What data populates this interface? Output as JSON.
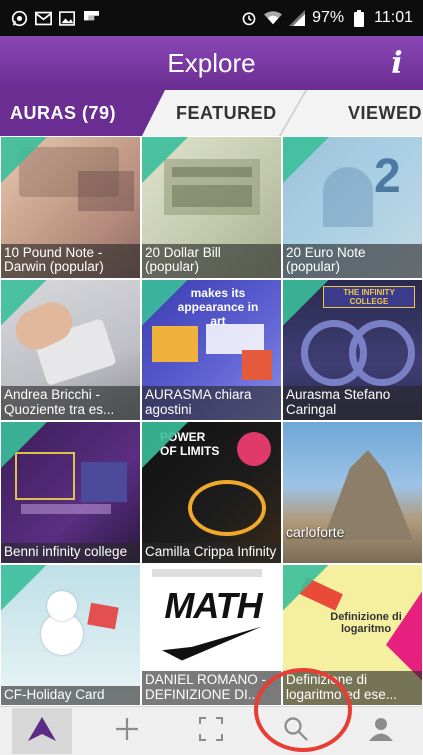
{
  "status_bar": {
    "battery": "97%",
    "time": "11:01",
    "icons_left": [
      "whatsapp-icon",
      "gmail-icon",
      "gallery-icon",
      "flipboard-icon"
    ],
    "icons_right": [
      "alarm-icon",
      "wifi-icon",
      "signal-icon",
      "battery-icon"
    ]
  },
  "header": {
    "title": "Explore",
    "info_label": "i"
  },
  "tabs": [
    {
      "label": "AURAS (79)",
      "active": true
    },
    {
      "label": "FEATURED",
      "active": false
    },
    {
      "label": "VIEWED",
      "active": false
    }
  ],
  "auras": [
    {
      "title": "10 Pound Note - Darwin (popular)"
    },
    {
      "title": "20 Dollar Bill (popular)"
    },
    {
      "title": "20 Euro Note (popular)"
    },
    {
      "title": "Andrea Bricchi - Quoziente tra es..."
    },
    {
      "title": "AURASMA chiara agostini"
    },
    {
      "title": "Aurasma Stefano Caringal"
    },
    {
      "title": "Benni infinity college"
    },
    {
      "title": "Camilla Crippa Infinity"
    },
    {
      "title": "carloforte"
    },
    {
      "title": "CF-Holiday Card"
    },
    {
      "title": "DANIEL ROMANO - DEFINIZIONE DI..."
    },
    {
      "title": "Definizione di logaritmo ed ese..."
    }
  ],
  "tile_art_text": {
    "math": "MATH",
    "definizione": "Definizione di logaritmo",
    "infinity": "THE INFINITY COLLEGE",
    "power": "POWER OF LIMITS",
    "art": "makes its appearance in art"
  },
  "bottom_nav": [
    {
      "name": "explore-icon",
      "active": true
    },
    {
      "name": "add-icon",
      "active": false
    },
    {
      "name": "scan-icon",
      "active": false
    },
    {
      "name": "search-icon",
      "active": false
    },
    {
      "name": "profile-icon",
      "active": false
    }
  ],
  "colors": {
    "brand_purple": "#6a2d92",
    "teal_corner": "#3bbf9a",
    "annotation_red": "#e83d35"
  }
}
